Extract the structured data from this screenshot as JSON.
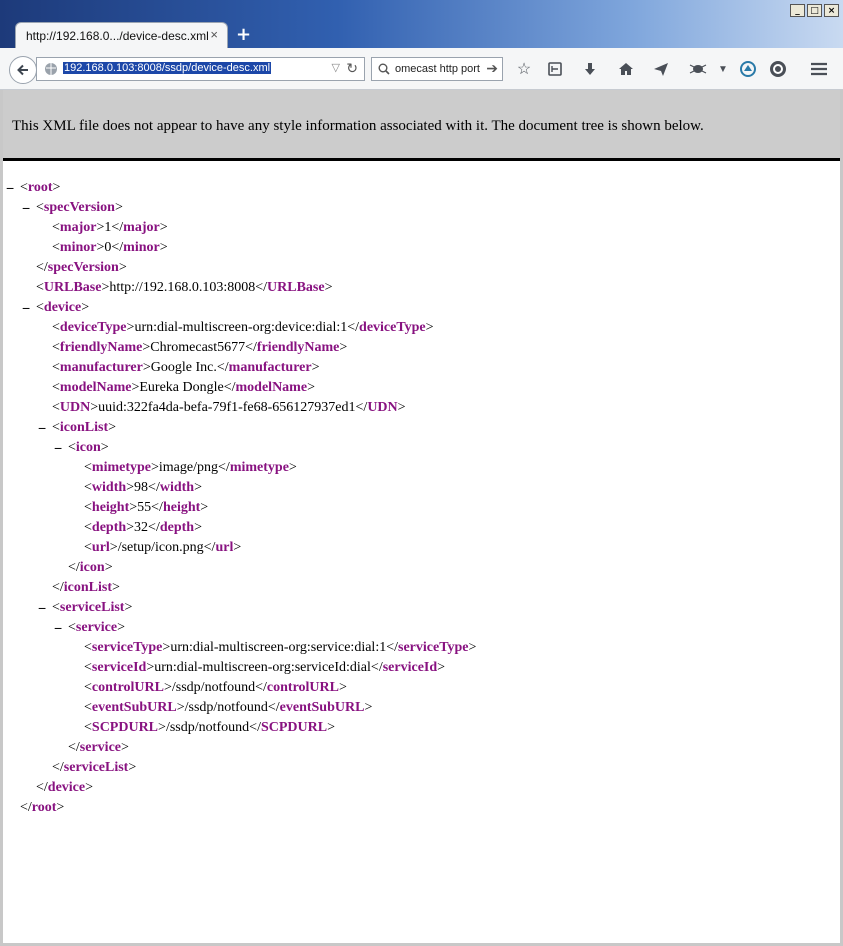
{
  "browser": {
    "tab_title": "http://192.168.0.../device-desc.xml",
    "tab_close": "×",
    "new_tab": "+",
    "url": "192.168.0.103:8008/ssdp/device-desc.xml",
    "search_text": "omecast http port"
  },
  "window_controls": {
    "minimize": "_",
    "maximize": "□",
    "close": "×"
  },
  "xml_info": "This XML file does not appear to have any style information associated with it. The document tree is shown below.",
  "tags": {
    "root": "root",
    "specVersion": "specVersion",
    "major": "major",
    "minor": "minor",
    "URLBase": "URLBase",
    "device": "device",
    "deviceType": "deviceType",
    "friendlyName": "friendlyName",
    "manufacturer": "manufacturer",
    "modelName": "modelName",
    "UDN": "UDN",
    "iconList": "iconList",
    "icon": "icon",
    "mimetype": "mimetype",
    "width": "width",
    "height": "height",
    "depth": "depth",
    "url": "url",
    "serviceList": "serviceList",
    "service": "service",
    "serviceType": "serviceType",
    "serviceId": "serviceId",
    "controlURL": "controlURL",
    "eventSubURL": "eventSubURL",
    "SCPDURL": "SCPDURL"
  },
  "values": {
    "major": "1",
    "minor": "0",
    "URLBase": "http://192.168.0.103:8008",
    "deviceType": "urn:dial-multiscreen-org:device:dial:1",
    "friendlyName": "Chromecast5677",
    "manufacturer": "Google Inc.",
    "modelName": "Eureka Dongle",
    "UDN": "uuid:322fa4da-befa-79f1-fe68-656127937ed1",
    "mimetype": "image/png",
    "width": "98",
    "height": "55",
    "depth": "32",
    "url": "/setup/icon.png",
    "serviceType": "urn:dial-multiscreen-org:service:dial:1",
    "serviceId": "urn:dial-multiscreen-org:serviceId:dial",
    "controlURL": "/ssdp/notfound",
    "eventSubURL": "/ssdp/notfound",
    "SCPDURL": "/ssdp/notfound"
  },
  "fold_symbol": "−"
}
